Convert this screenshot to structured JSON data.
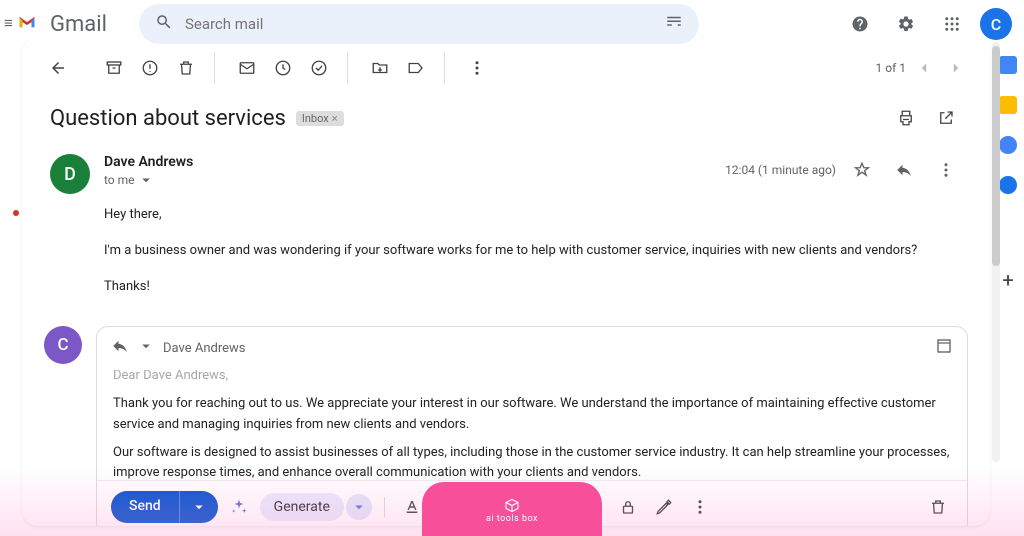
{
  "header": {
    "logo_text": "Gmail",
    "search_placeholder": "Search mail"
  },
  "toolbar": {
    "page_count": "1 of 1"
  },
  "email": {
    "subject": "Question about services",
    "label": "Inbox",
    "sender_initial": "D",
    "sender_name": "Dave Andrews",
    "to_line": "to me",
    "timestamp": "12:04 (1 minute ago)",
    "body": {
      "p1": "Hey there,",
      "p2": "I'm a business owner and was wondering if your software works for me to help with customer service, inquiries with new clients and vendors?",
      "p3": "Thanks!"
    }
  },
  "compose": {
    "avatar_initial": "C",
    "recipient": "Dave Andrews",
    "body": {
      "p0": "Dear Dave Andrews,",
      "p1": "Thank you for reaching out to us. We appreciate your interest in our software. We understand the importance of maintaining effective customer service and managing inquiries from new clients and vendors.",
      "p2": "Our software is designed to assist businesses of all types, including those in the customer service industry. It can help streamline your processes, improve response times, and enhance overall communication with your clients and vendors."
    },
    "send_label": "Send",
    "generate_label": "Generate"
  },
  "account": {
    "initial": "C"
  },
  "badge": {
    "text": "ai tools box"
  }
}
